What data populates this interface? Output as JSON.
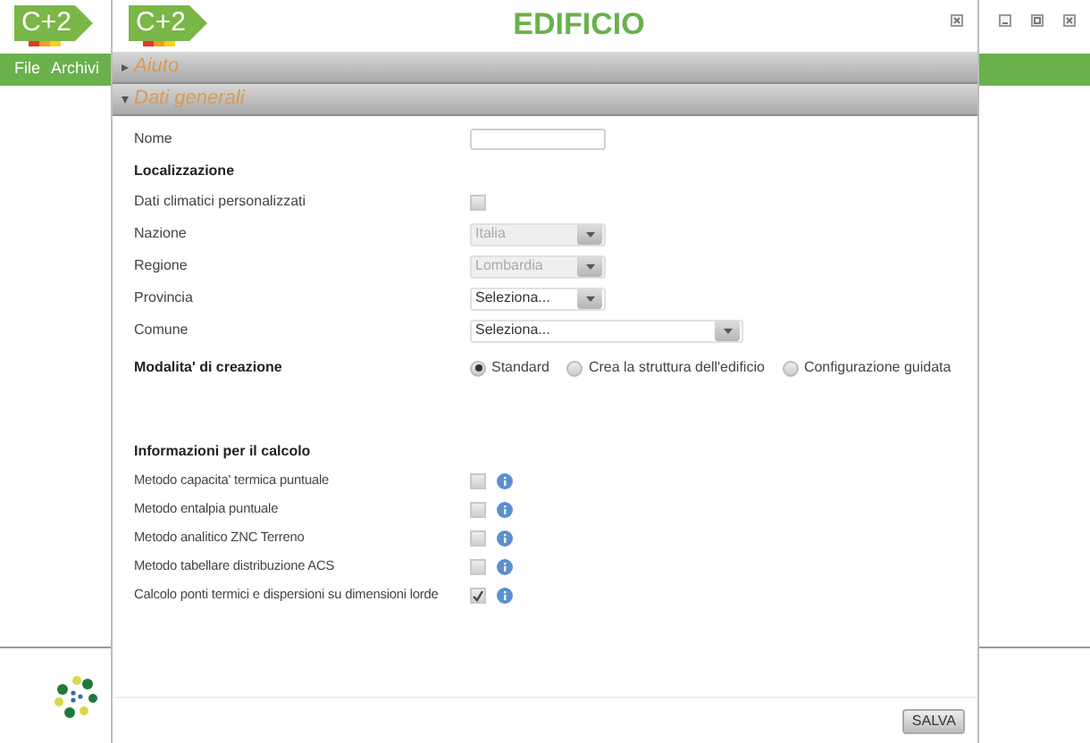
{
  "app": {
    "logo": "C+2",
    "menu": [
      "File",
      "Archivi"
    ]
  },
  "window": {
    "logo": "C+2",
    "title": "EDIFICIO"
  },
  "sections": [
    {
      "title": "Aiuto",
      "expanded": false
    },
    {
      "title": "Dati generali",
      "expanded": true
    }
  ],
  "fields": [
    {
      "kind": "text",
      "label": "Nome"
    },
    {
      "kind": "heading",
      "label": "Localizzazione"
    },
    {
      "kind": "checkbox",
      "label": "Dati climatici personalizzati",
      "checked": false
    },
    {
      "kind": "select",
      "label": "Nazione",
      "value": "Italia",
      "disabled": true,
      "wide": false
    },
    {
      "kind": "select",
      "label": "Regione",
      "value": "Lombardia",
      "disabled": true,
      "wide": false
    },
    {
      "kind": "select",
      "label": "Provincia",
      "value": "Seleziona...",
      "disabled": false,
      "wide": false
    },
    {
      "kind": "select",
      "label": "Comune",
      "value": "Seleziona...",
      "disabled": false,
      "wide": true
    },
    {
      "kind": "radio",
      "label": "Modalita' di creazione",
      "options": [
        {
          "label": "Standard",
          "selected": true
        },
        {
          "label": "Crea la struttura dell'edificio",
          "selected": false
        },
        {
          "label": "Configurazione guidata",
          "selected": false
        }
      ]
    }
  ],
  "calc": {
    "heading": "Informazioni per il calcolo",
    "options": [
      {
        "label": "Metodo capacita' termica puntuale",
        "checked": false
      },
      {
        "label": "Metodo entalpia puntuale",
        "checked": false
      },
      {
        "label": "Metodo analitico ZNC Terreno",
        "checked": false
      },
      {
        "label": "Metodo tabellare distribuzione ACS",
        "checked": false
      },
      {
        "label": "Calcolo ponti termici e dispersioni su dimensioni lorde",
        "checked": true
      }
    ]
  },
  "save_button": "SALVA"
}
